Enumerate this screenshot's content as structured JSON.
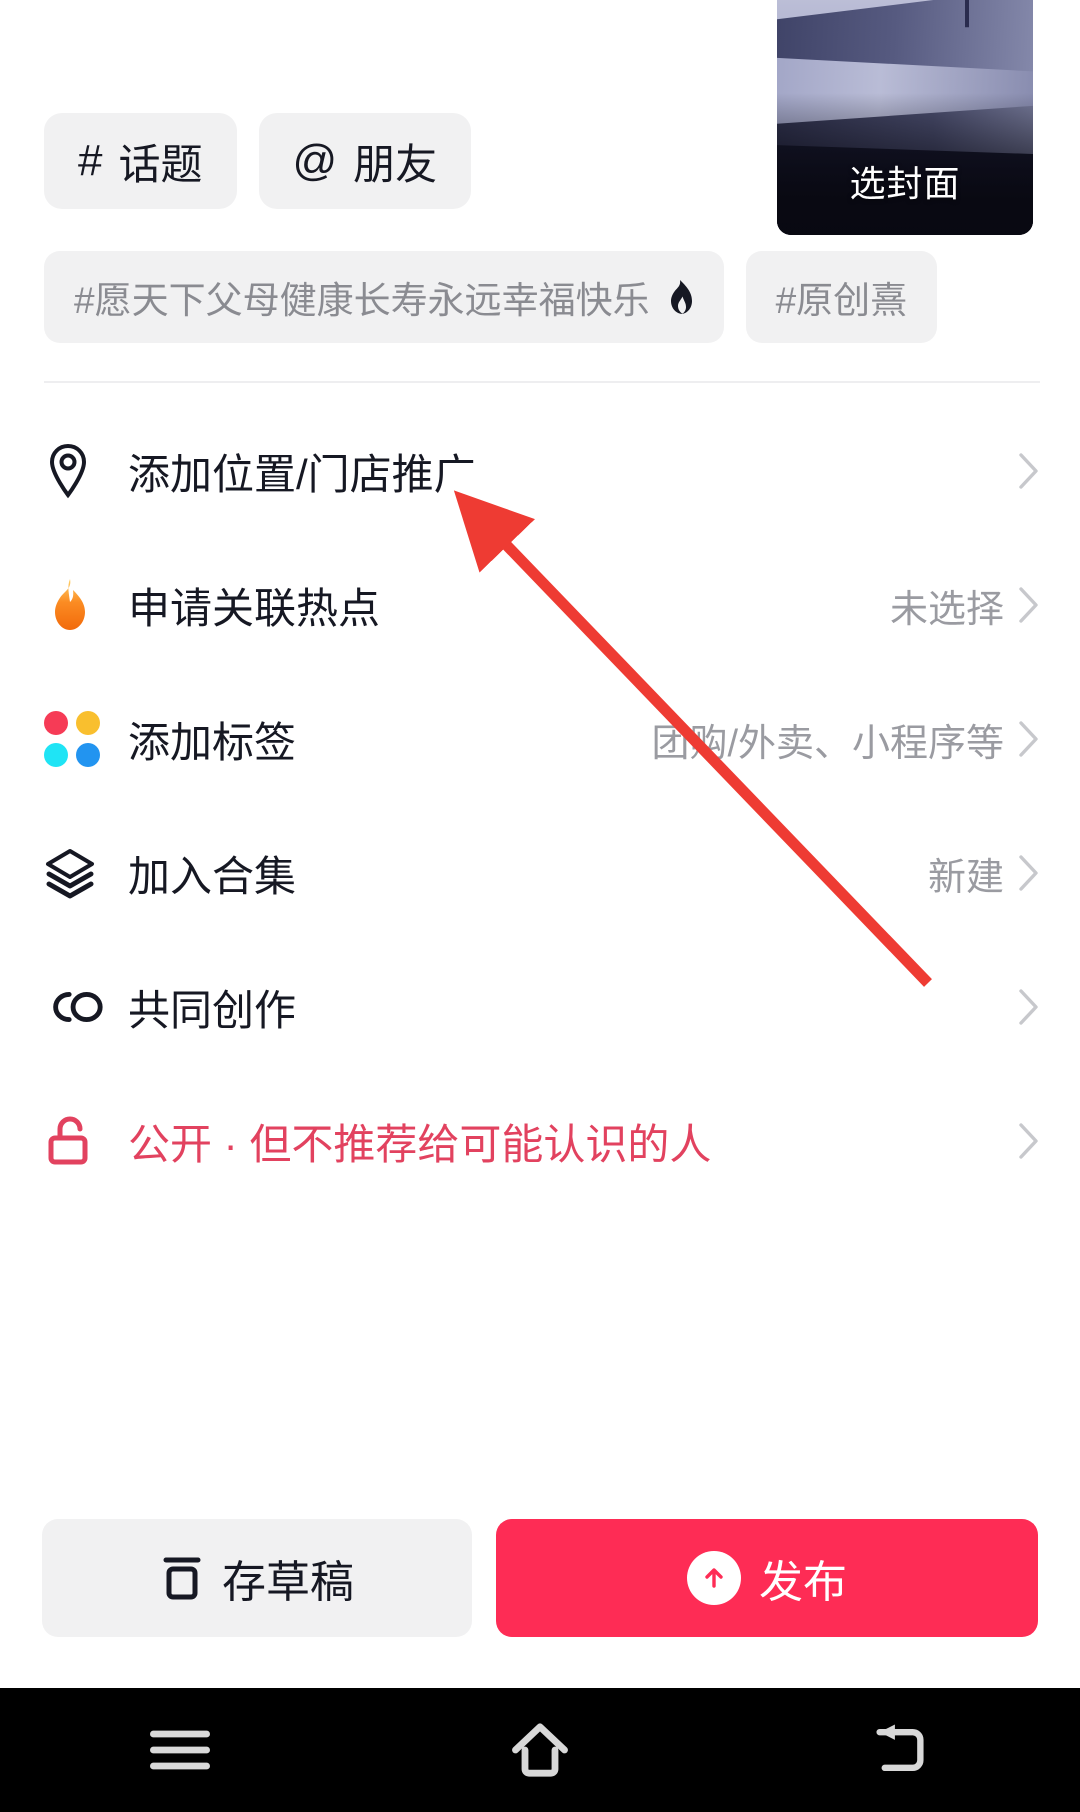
{
  "cover": {
    "label": "选封面",
    "icon": "cover-thumbnail"
  },
  "chips": [
    {
      "symbol": "#",
      "label": "话题",
      "name": "topic-chip"
    },
    {
      "symbol": "@",
      "label": "朋友",
      "name": "friend-chip"
    }
  ],
  "tag_suggestions": [
    {
      "text": "#愿天下父母健康长寿永远幸福快乐",
      "hot": true
    },
    {
      "text": "#原创熹",
      "hot": false
    }
  ],
  "rows": [
    {
      "icon": "location-pin-icon",
      "label": "添加位置/门店推广",
      "value": "",
      "name": "row-add-location"
    },
    {
      "icon": "flame-icon",
      "label": "申请关联热点",
      "value": "未选择",
      "name": "row-apply-hotspot"
    },
    {
      "icon": "four-dots-icon",
      "label": "添加标签",
      "value": "团购/外卖、小程序等",
      "name": "row-add-tag"
    },
    {
      "icon": "layers-icon",
      "label": "加入合集",
      "value": "新建",
      "name": "row-join-collection"
    },
    {
      "icon": "co-create-icon",
      "label": "共同创作",
      "value": "",
      "name": "row-co-create"
    },
    {
      "icon": "unlock-icon",
      "label": "公开 · 但不推荐给可能认识的人",
      "value": "",
      "name": "row-privacy"
    }
  ],
  "actions": {
    "draft_label": "存草稿",
    "publish_label": "发布"
  },
  "navbar": {
    "menu": "menu-icon",
    "home": "home-icon",
    "back": "back-icon"
  },
  "colors": {
    "accent_red": "#FE2C55",
    "privacy_red": "#E2425F",
    "chip_bg": "#F1F1F2",
    "text_primary": "#161823",
    "text_secondary": "#9A9BA1",
    "annotation_arrow": "#EE3B33"
  }
}
